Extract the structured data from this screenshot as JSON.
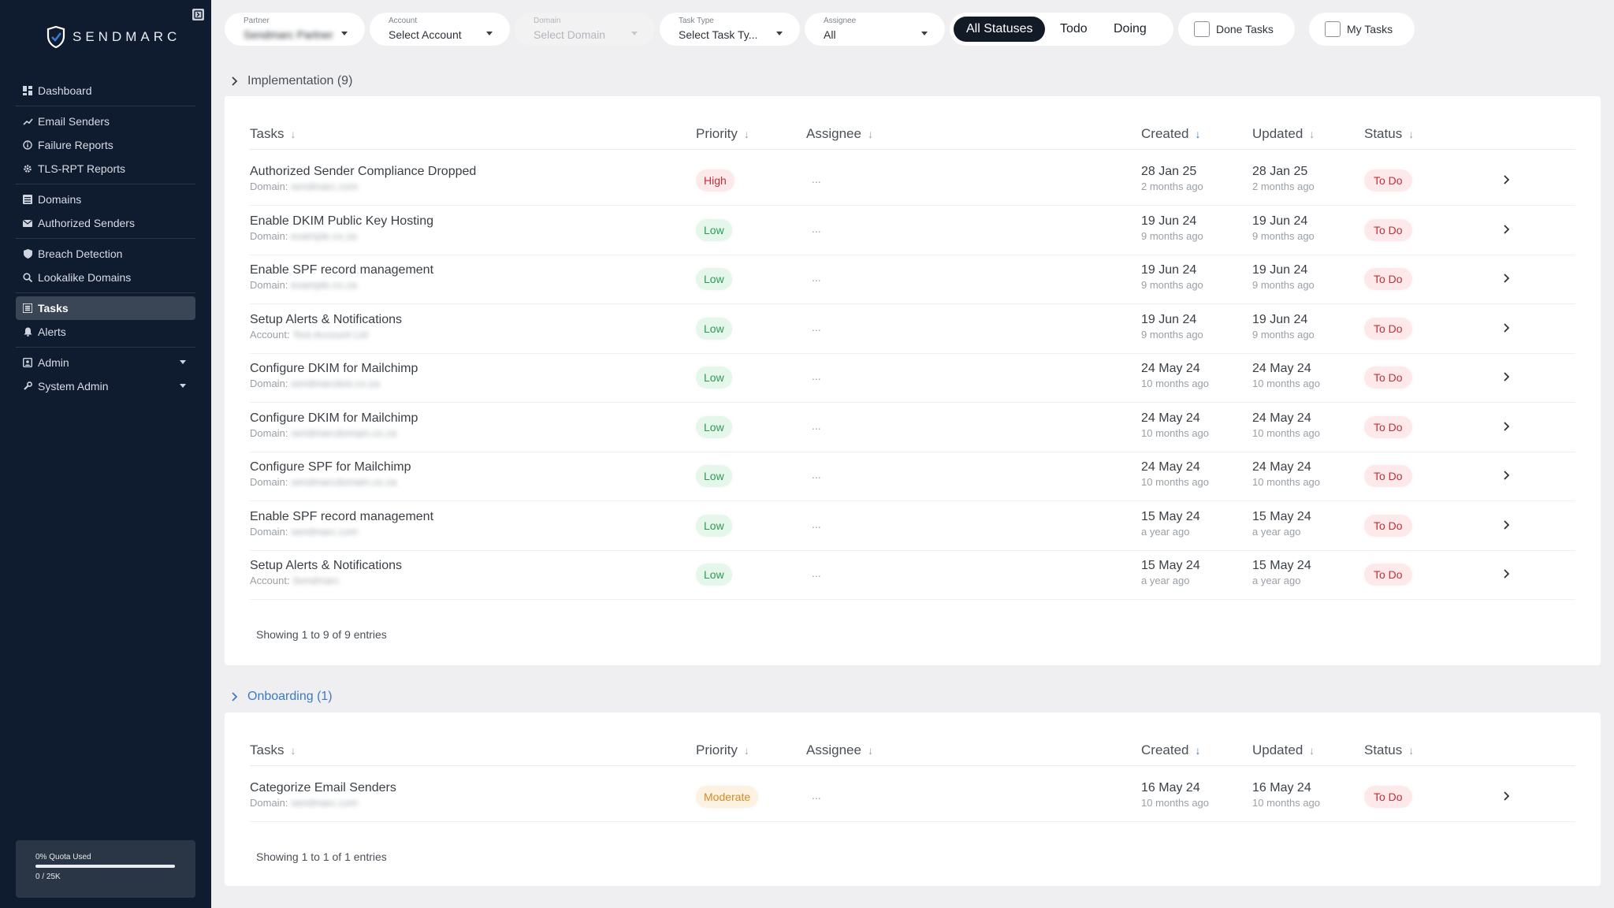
{
  "sidebar": {
    "logo_text": "SENDMARC",
    "items": [
      {
        "label": "Dashboard",
        "icon": "dashboard-icon"
      },
      {
        "label": "Email Senders",
        "icon": "trend-icon"
      },
      {
        "label": "Failure Reports",
        "icon": "info-icon"
      },
      {
        "label": "TLS-RPT Reports",
        "icon": "gear-icon"
      },
      {
        "label": "Domains",
        "icon": "list-icon"
      },
      {
        "label": "Authorized Senders",
        "icon": "mail-icon"
      },
      {
        "label": "Breach Detection",
        "icon": "shield-icon"
      },
      {
        "label": "Lookalike Domains",
        "icon": "search-icon"
      },
      {
        "label": "Tasks",
        "icon": "tasks-icon"
      },
      {
        "label": "Alerts",
        "icon": "bell-icon"
      },
      {
        "label": "Admin",
        "icon": "admin-icon"
      },
      {
        "label": "System Admin",
        "icon": "wrench-icon"
      }
    ],
    "quota_label": "0% Quota Used",
    "quota_count": "0 / 25K"
  },
  "filters": {
    "partner": {
      "label": "Partner",
      "value": "Sendmarc Partner"
    },
    "account": {
      "label": "Account",
      "value": "Select Account"
    },
    "domain": {
      "label": "Domain",
      "value": "Select Domain"
    },
    "task_type": {
      "label": "Task Type",
      "value": "Select Task Ty..."
    },
    "assignee": {
      "label": "Assignee",
      "value": "All"
    },
    "statuses": [
      "All Statuses",
      "Todo",
      "Doing"
    ],
    "done_tasks": "Done Tasks",
    "my_tasks": "My Tasks"
  },
  "columns": {
    "tasks": "Tasks",
    "priority": "Priority",
    "assignee": "Assignee",
    "created": "Created",
    "updated": "Updated",
    "status": "Status"
  },
  "sections": [
    {
      "title": "Implementation (9)",
      "footer": "Showing 1 to 9 of 9 entries",
      "rows": [
        {
          "title": "Authorized Sender Compliance Dropped",
          "sub_label": "Domain:",
          "sub_value": "sendmarc.com",
          "priority": "High",
          "priority_class": "high",
          "assignee": "...",
          "created": "28 Jan 25",
          "created_ago": "2 months ago",
          "updated": "28 Jan 25",
          "updated_ago": "2 months ago",
          "status": "To Do"
        },
        {
          "title": "Enable DKIM Public Key Hosting",
          "sub_label": "Domain:",
          "sub_value": "example.co.za",
          "priority": "Low",
          "priority_class": "low",
          "assignee": "...",
          "created": "19 Jun 24",
          "created_ago": "9 months ago",
          "updated": "19 Jun 24",
          "updated_ago": "9 months ago",
          "status": "To Do"
        },
        {
          "title": "Enable SPF record management",
          "sub_label": "Domain:",
          "sub_value": "example.co.za",
          "priority": "Low",
          "priority_class": "low",
          "assignee": "...",
          "created": "19 Jun 24",
          "created_ago": "9 months ago",
          "updated": "19 Jun 24",
          "updated_ago": "9 months ago",
          "status": "To Do"
        },
        {
          "title": "Setup Alerts & Notifications",
          "sub_label": "Account:",
          "sub_value": "Test Account Ltd",
          "priority": "Low",
          "priority_class": "low",
          "assignee": "...",
          "created": "19 Jun 24",
          "created_ago": "9 months ago",
          "updated": "19 Jun 24",
          "updated_ago": "9 months ago",
          "status": "To Do"
        },
        {
          "title": "Configure DKIM for Mailchimp",
          "sub_label": "Domain:",
          "sub_value": "sendmarctest.co.za",
          "priority": "Low",
          "priority_class": "low",
          "assignee": "...",
          "created": "24 May 24",
          "created_ago": "10 months ago",
          "updated": "24 May 24",
          "updated_ago": "10 months ago",
          "status": "To Do"
        },
        {
          "title": "Configure DKIM for Mailchimp",
          "sub_label": "Domain:",
          "sub_value": "sendmarcdomain.co.za",
          "priority": "Low",
          "priority_class": "low",
          "assignee": "...",
          "created": "24 May 24",
          "created_ago": "10 months ago",
          "updated": "24 May 24",
          "updated_ago": "10 months ago",
          "status": "To Do"
        },
        {
          "title": "Configure SPF for Mailchimp",
          "sub_label": "Domain:",
          "sub_value": "sendmarcdomain.co.za",
          "priority": "Low",
          "priority_class": "low",
          "assignee": "...",
          "created": "24 May 24",
          "created_ago": "10 months ago",
          "updated": "24 May 24",
          "updated_ago": "10 months ago",
          "status": "To Do"
        },
        {
          "title": "Enable SPF record management",
          "sub_label": "Domain:",
          "sub_value": "sendmarc.com",
          "priority": "Low",
          "priority_class": "low",
          "assignee": "...",
          "created": "15 May 24",
          "created_ago": "a year ago",
          "updated": "15 May 24",
          "updated_ago": "a year ago",
          "status": "To Do"
        },
        {
          "title": "Setup Alerts & Notifications",
          "sub_label": "Account:",
          "sub_value": "Sendmarc",
          "priority": "Low",
          "priority_class": "low",
          "assignee": "...",
          "created": "15 May 24",
          "created_ago": "a year ago",
          "updated": "15 May 24",
          "updated_ago": "a year ago",
          "status": "To Do"
        }
      ]
    },
    {
      "title": "Onboarding (1)",
      "footer": "Showing 1 to 1 of 1 entries",
      "rows": [
        {
          "title": "Categorize Email Senders",
          "sub_label": "Domain:",
          "sub_value": "sendmarc.com",
          "priority": "Moderate",
          "priority_class": "moderate",
          "assignee": "...",
          "created": "16 May 24",
          "created_ago": "10 months ago",
          "updated": "16 May 24",
          "updated_ago": "10 months ago",
          "status": "To Do"
        }
      ]
    }
  ],
  "colors": {
    "sidebar_bg": "#0f1b2e",
    "accent_blue": "#3b7ac6",
    "high": "#c0303a",
    "low": "#2f9a54",
    "moderate": "#d48a26"
  }
}
